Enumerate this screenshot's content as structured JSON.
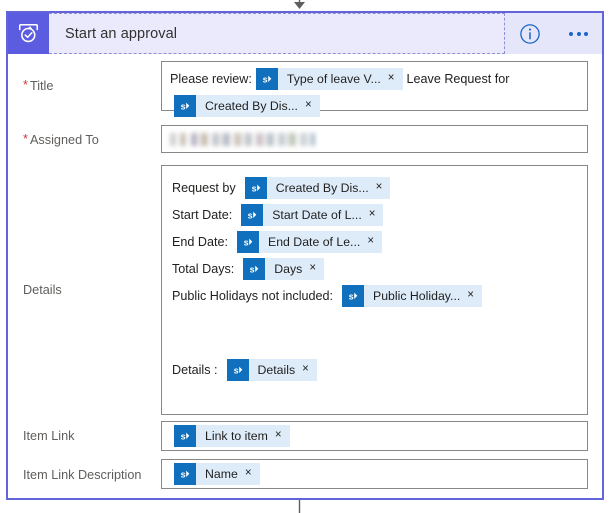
{
  "header": {
    "title": "Start an approval",
    "icon": "approval-icon",
    "info_icon": "info-icon",
    "more_icon": "ellipsis-icon",
    "badge_color": "#5c5ce0",
    "background_color": "#e6e6fb",
    "border_color": "#6264d8"
  },
  "fields": [
    {
      "key": "title",
      "label": "Title",
      "required": true,
      "required_marker": "*",
      "lines": [
        {
          "parts": [
            {
              "type": "text",
              "value": "Please review:"
            },
            {
              "type": "token",
              "value": "Type of leave V...",
              "icon": "sharepoint-icon",
              "close": "×"
            },
            {
              "type": "text",
              "value": "Leave Request for"
            }
          ]
        },
        {
          "parts": [
            {
              "type": "token",
              "value": "Created By Dis...",
              "icon": "sharepoint-icon",
              "close": "×"
            }
          ]
        }
      ]
    },
    {
      "key": "assigned_to",
      "label": "Assigned To",
      "required": true,
      "required_marker": "*",
      "value_redacted": true
    },
    {
      "key": "details",
      "label": "Details",
      "required": false,
      "lines": [
        {
          "parts": [
            {
              "type": "text",
              "value": "Request by"
            },
            {
              "type": "token",
              "value": "Created By Dis...",
              "icon": "sharepoint-icon",
              "close": "×"
            }
          ]
        },
        {
          "parts": [
            {
              "type": "text",
              "value": "Start Date:"
            },
            {
              "type": "token",
              "value": "Start Date of L...",
              "icon": "sharepoint-icon",
              "close": "×"
            }
          ]
        },
        {
          "parts": [
            {
              "type": "text",
              "value": "End Date:"
            },
            {
              "type": "token",
              "value": "End Date of Le...",
              "icon": "sharepoint-icon",
              "close": "×"
            }
          ]
        },
        {
          "parts": [
            {
              "type": "text",
              "value": "Total Days:"
            },
            {
              "type": "token",
              "value": "Days",
              "icon": "sharepoint-icon",
              "close": "×"
            }
          ]
        },
        {
          "parts": [
            {
              "type": "text",
              "value": "Public Holidays not included:"
            },
            {
              "type": "token",
              "value": "Public Holiday...",
              "icon": "sharepoint-icon",
              "close": "×"
            }
          ]
        },
        {
          "gap": true
        },
        {
          "parts": [
            {
              "type": "text",
              "value": "Details :"
            },
            {
              "type": "token",
              "value": "Details",
              "icon": "sharepoint-icon",
              "close": "×"
            }
          ]
        }
      ]
    },
    {
      "key": "item_link",
      "label": "Item Link",
      "required": false,
      "lines": [
        {
          "parts": [
            {
              "type": "token",
              "value": "Link to item",
              "icon": "sharepoint-icon",
              "close": "×"
            }
          ]
        }
      ]
    },
    {
      "key": "item_link_description",
      "label": "Item Link Description",
      "required": false,
      "lines": [
        {
          "parts": [
            {
              "type": "token",
              "value": "Name",
              "icon": "sharepoint-icon",
              "close": "×"
            }
          ]
        }
      ]
    }
  ]
}
